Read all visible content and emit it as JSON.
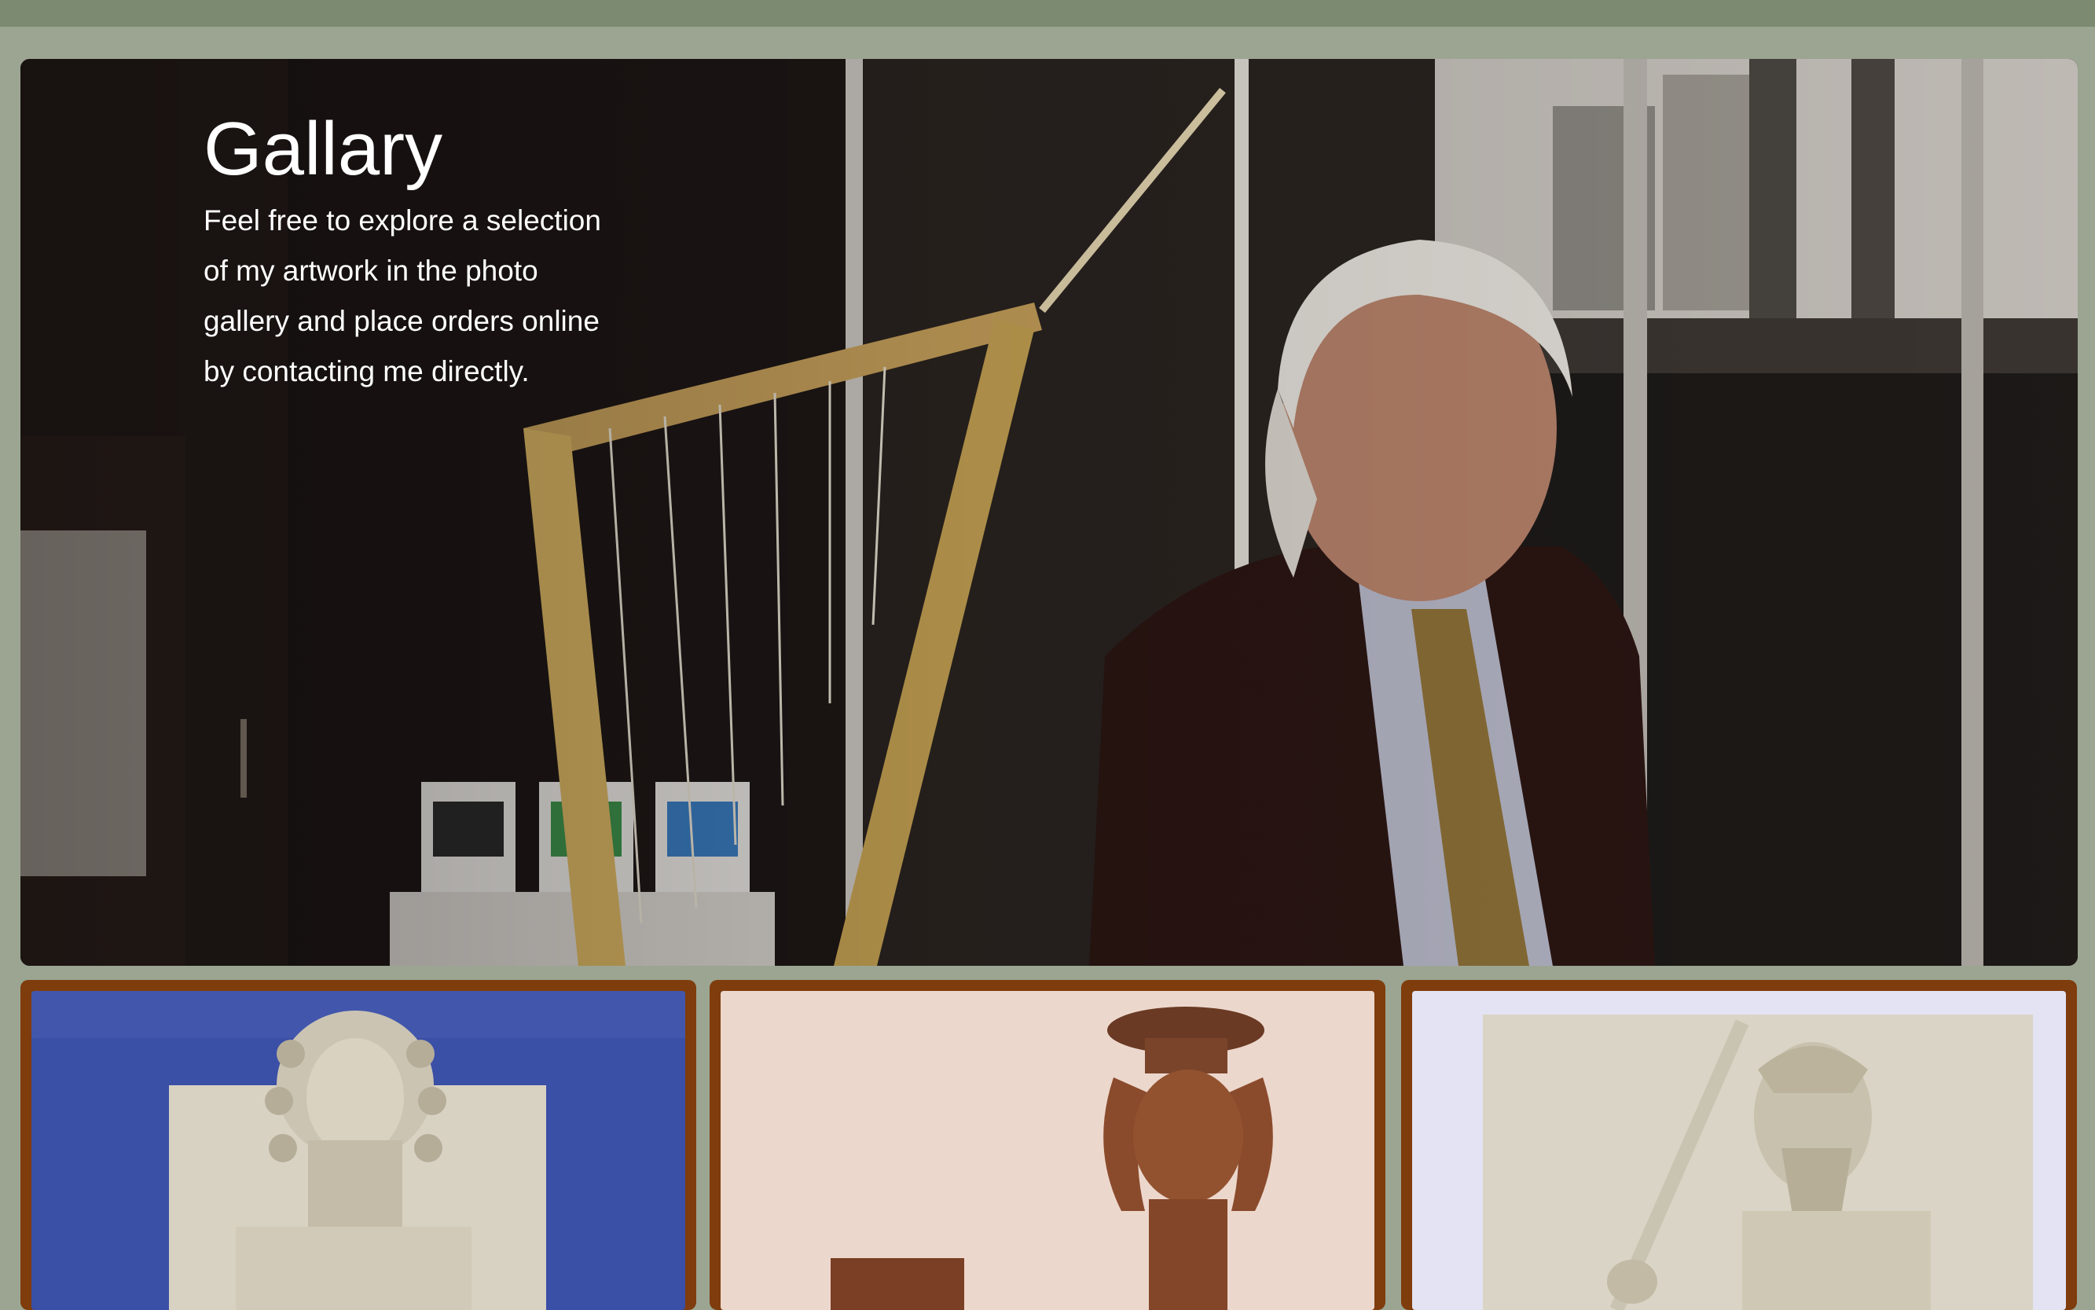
{
  "hero": {
    "title": "Gallary",
    "description_lines": [
      "Feel free to explore a selection",
      "of my artwork in the photo",
      "gallery and place orders online",
      "by contacting me directly."
    ],
    "photo_subject": "artist-with-harp-sculpture"
  },
  "gallery": {
    "items": [
      {
        "subject": "sumerian-king-relief",
        "background": "#3a4fa6"
      },
      {
        "subject": "terracotta-figure-with-bowl",
        "background": "#e9d3c7"
      },
      {
        "subject": "assyrian-warrior-relief",
        "background": "#e3e3f3"
      }
    ]
  },
  "colors": {
    "page_background": "#9ba592",
    "top_bar": "#7b8a70",
    "card_border": "#7f3c0c",
    "hero_text": "#ffffff"
  }
}
